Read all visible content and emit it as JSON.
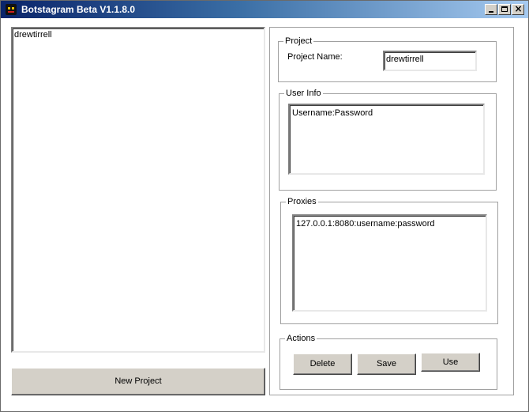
{
  "window": {
    "title": "Botstagram Beta V1.1.8.0"
  },
  "project_list": {
    "items": [
      "drewtirrell"
    ]
  },
  "new_project_label": "New Project",
  "project_group": {
    "title": "Project",
    "name_label": "Project Name:",
    "name_value": "drewtirrell"
  },
  "user_info_group": {
    "title": "User Info",
    "text": "Username:Password"
  },
  "proxies_group": {
    "title": "Proxies",
    "text": "127.0.0.1:8080:username:password"
  },
  "actions_group": {
    "title": "Actions",
    "delete_label": "Delete",
    "save_label": "Save",
    "use_label": "Use"
  }
}
